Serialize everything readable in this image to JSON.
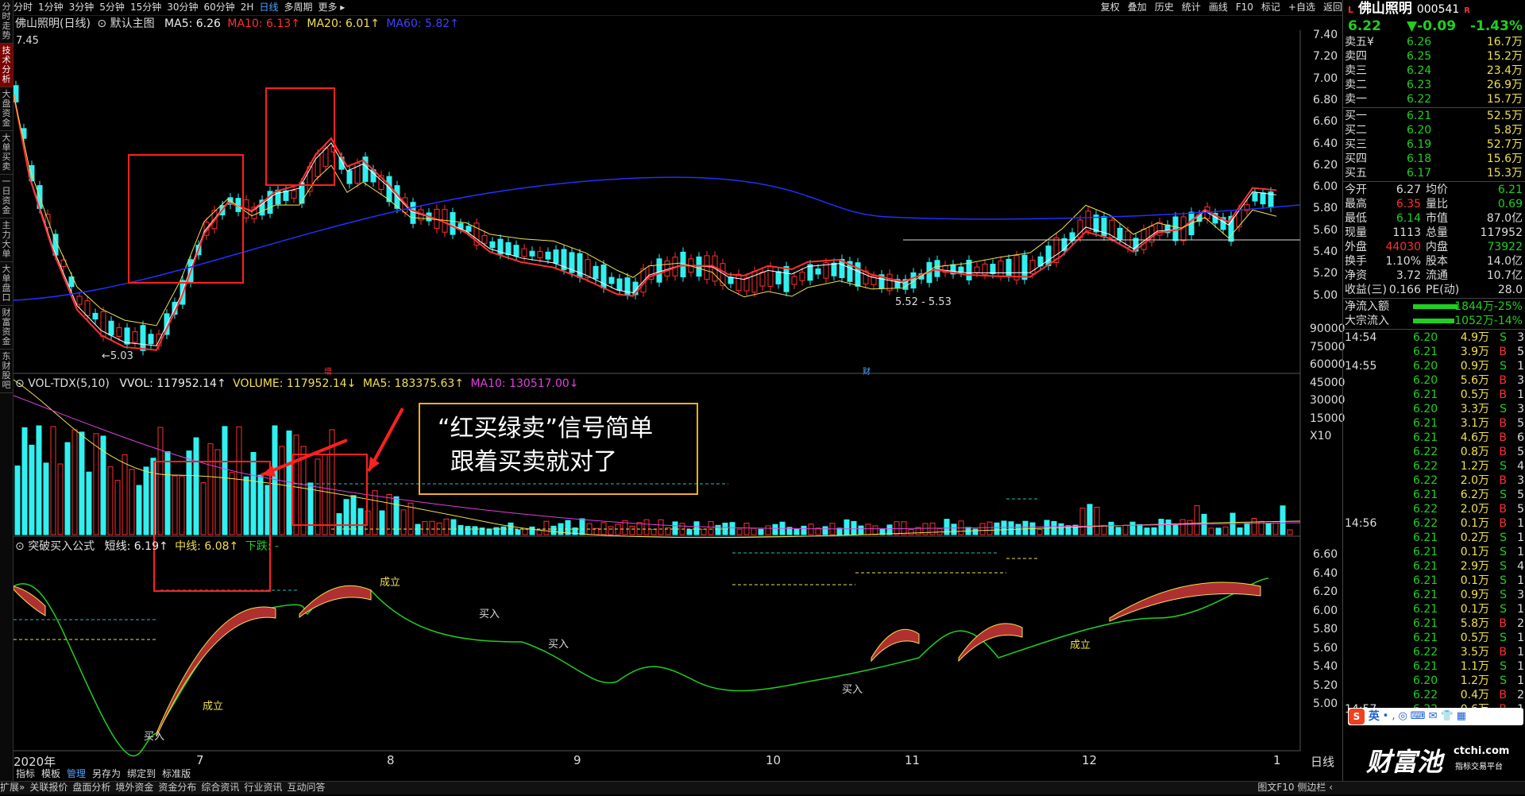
{
  "window": {
    "title": "佛山照明",
    "code": "000541"
  },
  "left_tabs": [
    "分时走势",
    "技术分析",
    "大盘资金",
    "大单买卖",
    "一日资金",
    "主力大单",
    "大单盘口",
    "财富资金",
    "东财股吧"
  ],
  "toolbar": {
    "periods": [
      "分时",
      "1分钟",
      "3分钟",
      "5分钟",
      "15分钟",
      "30分钟",
      "60分钟",
      "2H",
      "日线",
      "多周期",
      "更多 ▸"
    ],
    "active": "日线",
    "right": [
      "复权",
      "叠加",
      "历史",
      "统计",
      "画线",
      "F10",
      "标记",
      "+自选",
      "返回"
    ]
  },
  "main_legend": {
    "name": "佛山照明(日线)",
    "template": "默认主图",
    "ma5": "MA5: 6.26",
    "ma10": "MA10: 6.13↑",
    "ma20": "MA20: 6.01↑",
    "ma60": "MA60: 5.82↑"
  },
  "price_axis": [
    "7.40",
    "7.20",
    "7.00",
    "6.80",
    "6.60",
    "6.40",
    "6.20",
    "6.00",
    "5.80",
    "5.60",
    "5.40",
    "5.20",
    "5.00"
  ],
  "vol_axis": [
    "90000",
    "75000",
    "60000",
    "45000",
    "30000",
    "15000",
    "X10"
  ],
  "ind_axis": [
    "6.60",
    "6.40",
    "6.20",
    "6.00",
    "5.80",
    "5.60",
    "5.40",
    "5.20",
    "5.00"
  ],
  "price_labels": {
    "high": "7.45",
    "low": "←5.03",
    "range": "5.52 - 5.53"
  },
  "event_marks": [
    "增",
    "财"
  ],
  "vol_legend": {
    "name": "VOL-TDX(5,10)",
    "vvol": "VVOL: 117952.14↑",
    "volume": "VOLUME: 117952.14↓",
    "ma5": "MA5: 183375.63↑",
    "ma10": "MA10: 130517.00↓"
  },
  "ind_legend": {
    "name": "突破买入公式",
    "short": "短线: 6.19↑",
    "mid": "中线: 6.08↑",
    "fall": "下跌: -"
  },
  "signals": {
    "buy": "买入",
    "ok": "成立"
  },
  "callout": {
    "line1": "“红买绿卖”信号简单",
    "line2": "跟着买卖就对了"
  },
  "x_axis": [
    "2020年",
    "7",
    "8",
    "9",
    "10",
    "11",
    "12",
    "1"
  ],
  "x_axis_right": "日线",
  "quote": {
    "price": "6.22",
    "change": "▼-0.09",
    "pct": "-1.43%"
  },
  "sells": [
    {
      "l": "卖五¥",
      "p": "6.26",
      "v": "16.7万"
    },
    {
      "l": "卖四",
      "p": "6.25",
      "v": "15.2万"
    },
    {
      "l": "卖三",
      "p": "6.24",
      "v": "23.4万"
    },
    {
      "l": "卖二",
      "p": "6.23",
      "v": "26.9万"
    },
    {
      "l": "卖一",
      "p": "6.22",
      "v": "15.7万"
    }
  ],
  "buys": [
    {
      "l": "买一",
      "p": "6.21",
      "v": "52.5万"
    },
    {
      "l": "买二",
      "p": "6.20",
      "v": "5.8万"
    },
    {
      "l": "买三",
      "p": "6.19",
      "v": "52.7万"
    },
    {
      "l": "买四",
      "p": "6.18",
      "v": "15.6万"
    },
    {
      "l": "买五",
      "p": "6.17",
      "v": "15.3万"
    }
  ],
  "stats": [
    {
      "a": "今开",
      "b": "6.27",
      "c": "均价",
      "d": "6.21"
    },
    {
      "a": "最高",
      "b": "6.35",
      "c": "量比",
      "d": "0.69"
    },
    {
      "a": "最低",
      "b": "6.14",
      "c": "市值",
      "d": "87.0亿"
    },
    {
      "a": "现量",
      "b": "1113",
      "c": "总量",
      "d": "117952"
    },
    {
      "a": "外盘",
      "b": "44030",
      "c": "内盘",
      "d": "73922"
    },
    {
      "a": "换手",
      "b": "1.10%",
      "c": "股本",
      "d": "14.0亿"
    },
    {
      "a": "净资",
      "b": "3.72",
      "c": "流通",
      "d": "10.7亿"
    },
    {
      "a": "收益(三)",
      "b": "0.166",
      "c": "PE(动)",
      "d": "28.0"
    }
  ],
  "flows": [
    {
      "l": "净流入额",
      "v": "-1844万-25%"
    },
    {
      "l": "大宗流入",
      "v": "-1052万-14%"
    }
  ],
  "ticks": [
    {
      "t": "14:54",
      "p": "6.20",
      "v": "4.9万",
      "s": "S",
      "n": "3"
    },
    {
      "t": "",
      "p": "6.21",
      "v": "3.9万",
      "s": "B",
      "n": "5"
    },
    {
      "t": "14:55",
      "p": "6.20",
      "v": "0.9万",
      "s": "S",
      "n": "1"
    },
    {
      "t": "",
      "p": "6.20",
      "v": "5.6万",
      "s": "B",
      "n": "3"
    },
    {
      "t": "",
      "p": "6.21",
      "v": "0.5万",
      "s": "B",
      "n": "1"
    },
    {
      "t": "",
      "p": "6.20",
      "v": "3.3万",
      "s": "S",
      "n": "3"
    },
    {
      "t": "",
      "p": "6.21",
      "v": "3.1万",
      "s": "B",
      "n": "5"
    },
    {
      "t": "",
      "p": "6.21",
      "v": "4.6万",
      "s": "B",
      "n": "6"
    },
    {
      "t": "",
      "p": "6.22",
      "v": "0.8万",
      "s": "B",
      "n": "5"
    },
    {
      "t": "",
      "p": "6.22",
      "v": "1.2万",
      "s": "S",
      "n": "4"
    },
    {
      "t": "",
      "p": "6.22",
      "v": "2.0万",
      "s": "B",
      "n": "3"
    },
    {
      "t": "",
      "p": "6.21",
      "v": "6.2万",
      "s": "S",
      "n": "5"
    },
    {
      "t": "",
      "p": "6.22",
      "v": "2.0万",
      "s": "B",
      "n": "5"
    },
    {
      "t": "14:56",
      "p": "6.22",
      "v": "0.1万",
      "s": "B",
      "n": "1"
    },
    {
      "t": "",
      "p": "6.21",
      "v": "0.2万",
      "s": "S",
      "n": "1"
    },
    {
      "t": "",
      "p": "6.21",
      "v": "0.1万",
      "s": "S",
      "n": "1"
    },
    {
      "t": "",
      "p": "6.21",
      "v": "2.9万",
      "s": "S",
      "n": "4"
    },
    {
      "t": "",
      "p": "6.21",
      "v": "0.1万",
      "s": "S",
      "n": "1"
    },
    {
      "t": "",
      "p": "6.21",
      "v": "0.9万",
      "s": "S",
      "n": "3"
    },
    {
      "t": "",
      "p": "6.21",
      "v": "0.1万",
      "s": "S",
      "n": "1"
    },
    {
      "t": "",
      "p": "6.21",
      "v": "5.8万",
      "s": "B",
      "n": "2"
    },
    {
      "t": "",
      "p": "6.21",
      "v": "0.5万",
      "s": "S",
      "n": "1"
    },
    {
      "t": "",
      "p": "6.22",
      "v": "3.5万",
      "s": "B",
      "n": "1"
    },
    {
      "t": "",
      "p": "6.21",
      "v": "1.1万",
      "s": "S",
      "n": "1"
    },
    {
      "t": "",
      "p": "6.20",
      "v": "1.2万",
      "s": "S",
      "n": "1"
    },
    {
      "t": "",
      "p": "6.22",
      "v": "0.4万",
      "s": "B",
      "n": "2"
    },
    {
      "t": "14:57",
      "p": "6.22",
      "v": "0.6万",
      "s": "B",
      "n": "1"
    }
  ],
  "ime": {
    "logo": "S",
    "label": "英"
  },
  "watermark": {
    "brand": "财富池",
    "site": "ctchi.com",
    "slogan": "指标交易平台"
  },
  "side_bottom": [
    "笔",
    "价",
    "细",
    "势",
    "联",
    "值",
    "主",
    "筹"
  ],
  "bottom_bar": {
    "left": [
      "扩展»",
      "关联报价",
      "盘面分析",
      "境外资金",
      "资金分布",
      "综合资讯",
      "行业资讯",
      "互动问答"
    ],
    "sub": [
      "指标",
      "模板",
      "管理",
      "另存为",
      "绑定到",
      "标准版"
    ],
    "right": "图文F10 侧边栏 ‹"
  }
}
